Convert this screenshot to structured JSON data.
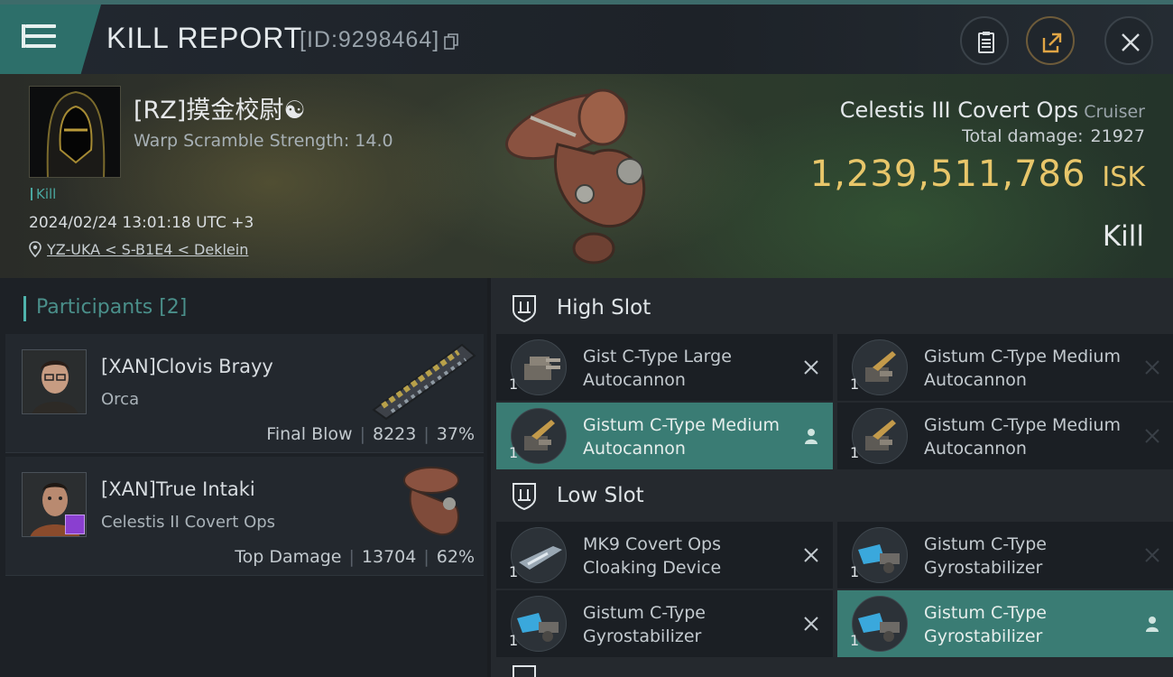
{
  "header": {
    "title": "KILL REPORT",
    "kill_id": "[ID:9298464]"
  },
  "summary": {
    "pilot_name": "[RZ]摸金校尉☯",
    "warp_scramble": "Warp Scramble Strength: 14.0",
    "kill_tag": "Kill",
    "timestamp": "2024/02/24 13:01:18 UTC +3",
    "location": "YZ-UKA < S-B1E4 < Deklein",
    "ship_name": "Celestis III Covert Ops",
    "ship_class": "Cruiser",
    "total_damage_label": "Total damage:",
    "total_damage": "21927",
    "isk_value": "1,239,511,786",
    "isk_unit": "ISK",
    "result": "Kill"
  },
  "participants": {
    "header": "Participants [2]",
    "items": [
      {
        "name": "[XAN]Clovis Brayy",
        "ship": "Orca",
        "role": "Final Blow",
        "damage": "8223",
        "percent": "37%"
      },
      {
        "name": "[XAN]True Intaki",
        "ship": "Celestis II Covert Ops",
        "role": "Top Damage",
        "damage": "13704",
        "percent": "62%"
      }
    ]
  },
  "fittings": {
    "high_slot_label": "High Slot",
    "low_slot_label": "Low Slot",
    "high": [
      {
        "name": "Gist C-Type Large Autocannon",
        "qty": "1",
        "mark": "destroyed"
      },
      {
        "name": "Gistum C-Type Medium Autocannon",
        "qty": "1",
        "mark": "destroyed"
      },
      {
        "name": "Gistum C-Type Medium Autocannon",
        "qty": "1",
        "mark": "dropped"
      },
      {
        "name": "Gistum C-Type Medium Autocannon",
        "qty": "1",
        "mark": "destroyed"
      }
    ],
    "low": [
      {
        "name": "MK9 Covert Ops Cloaking Device",
        "qty": "1",
        "mark": "destroyed"
      },
      {
        "name": "Gistum C-Type Gyrostabilizer",
        "qty": "1",
        "mark": "destroyed"
      },
      {
        "name": "Gistum C-Type Gyrostabilizer",
        "qty": "1",
        "mark": "destroyed"
      },
      {
        "name": "Gistum C-Type Gyrostabilizer",
        "qty": "1",
        "mark": "dropped"
      }
    ]
  },
  "colors": {
    "accent_teal": "#3a7c74",
    "isk_gold": "#e8c66a",
    "background": "#1b1f24"
  }
}
